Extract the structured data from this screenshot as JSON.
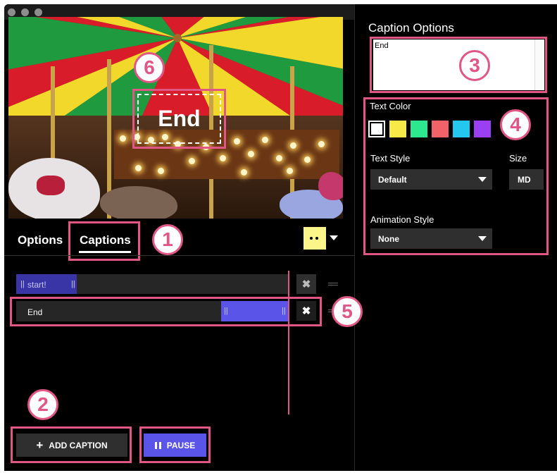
{
  "tabs": [
    {
      "label": "Options",
      "active": false
    },
    {
      "label": "Captions",
      "active": true
    }
  ],
  "video": {
    "caption_overlay": "End"
  },
  "timeline": {
    "captions": [
      {
        "label": "start!"
      },
      {
        "label": "End"
      }
    ],
    "remove_symbol": "✖"
  },
  "buttons": {
    "add_caption": "ADD CAPTION",
    "pause": "PAUSE"
  },
  "caption_options": {
    "title": "Caption Options",
    "text_value": "End",
    "text_color_label": "Text Color",
    "colors": [
      "#ffffff",
      "#f7ea48",
      "#2ee890",
      "#f16269",
      "#24c7f0",
      "#9b3ff2"
    ],
    "selected_color": "#ffffff",
    "text_style_label": "Text Style",
    "text_style_value": "Default",
    "size_label": "Size",
    "size_value": "MD",
    "animation_style_label": "Animation Style",
    "animation_style_value": "None"
  },
  "annotations": [
    "1",
    "2",
    "3",
    "4",
    "5",
    "6"
  ],
  "colors": {
    "accent": "#5b54e8",
    "highlight": "#e05684",
    "panel": "#000000"
  }
}
